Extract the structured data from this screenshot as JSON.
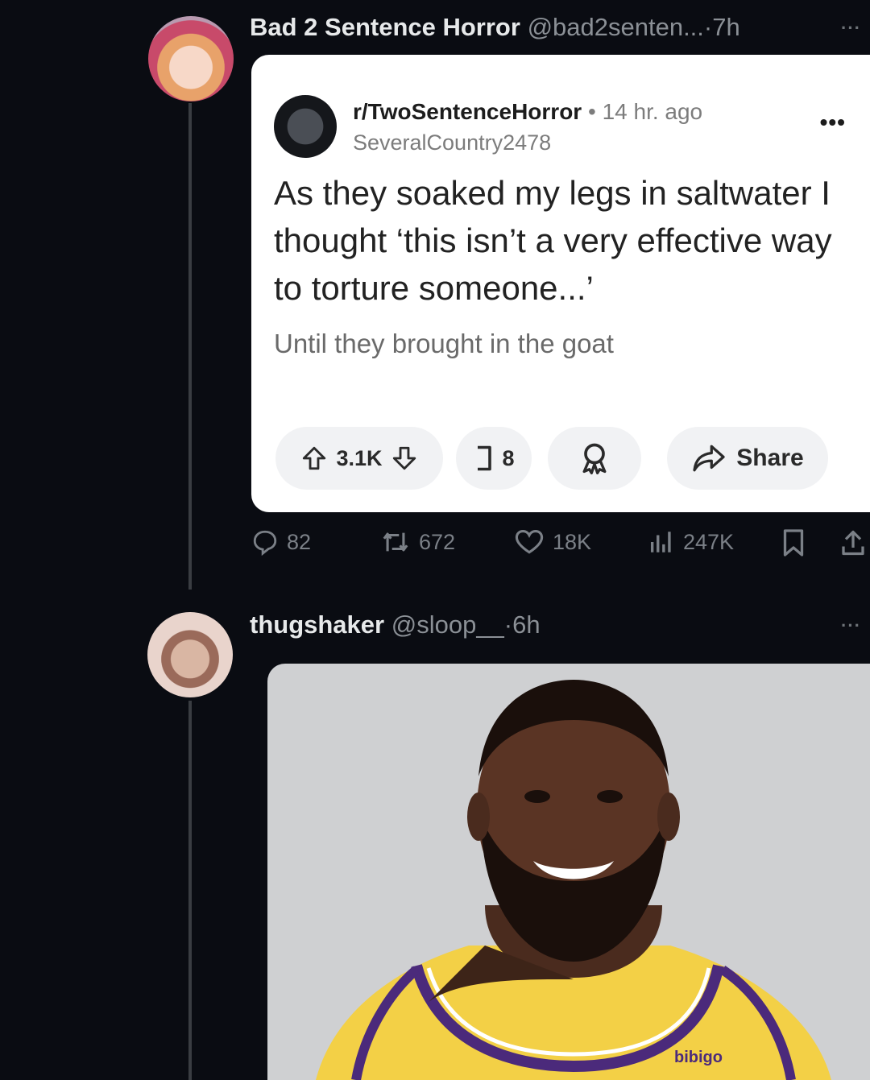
{
  "tweet1": {
    "name": "Bad 2 Sentence Horror",
    "handle": "@bad2senten...",
    "time": "·7h",
    "more": "···",
    "reddit": {
      "subreddit": "r/TwoSentenceHorror",
      "time": "• 14 hr. ago",
      "username": "SeveralCountry2478",
      "more": "•••",
      "title": "As they soaked my legs in saltwater I thought ‘this isn’t a very effective way to torture someone...’",
      "body": "Until they brought in the goat",
      "votes": "3.1K",
      "comments": "8",
      "share_label": "Share"
    },
    "actions": {
      "replies": "82",
      "reposts": "672",
      "likes": "18K",
      "views": "247K"
    }
  },
  "tweet2": {
    "name": "thugshaker",
    "handle": "@sloop__",
    "time": "·6h",
    "more": "···",
    "jersey_logo": "bibigo"
  },
  "colors": {
    "background": "#0a0c12",
    "card": "#ffffff",
    "muted": "#7b8087",
    "jersey": "#f3d046",
    "jersey_trim": "#4b2a7b"
  }
}
